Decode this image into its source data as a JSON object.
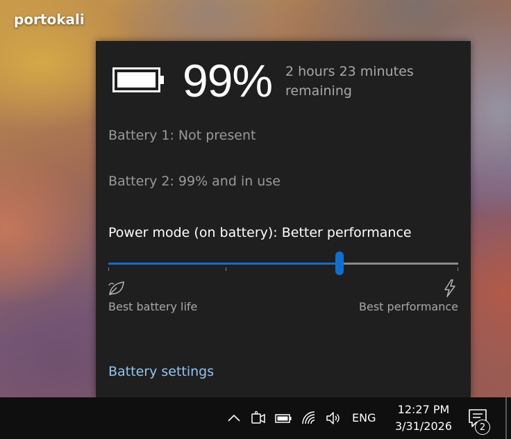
{
  "watermark": "portokali",
  "flyout": {
    "percent": "99%",
    "remaining": "2 hours 23 minutes remaining",
    "battery1": "Battery 1: Not present",
    "battery2": "Battery 2: 99% and in use",
    "power_mode_title": "Power mode (on battery): Better performance",
    "slider": {
      "level_fraction": 0.66,
      "steps": 4
    },
    "left_label": "Best battery life",
    "right_label": "Best performance",
    "settings_link": "Battery settings",
    "accent_color": "#0f6fd0",
    "link_color": "#93c5f0",
    "icons": {
      "battery": "battery-full-icon",
      "leaf": "leaf-icon",
      "bolt": "lightning-icon"
    }
  },
  "taskbar": {
    "language": "ENG",
    "time": "12:27 PM",
    "date": "3/31/2026",
    "notification_count": "2",
    "tray_icons": [
      "chevron-up-icon",
      "camera-icon",
      "battery-icon",
      "wifi-icon",
      "speaker-icon"
    ]
  }
}
